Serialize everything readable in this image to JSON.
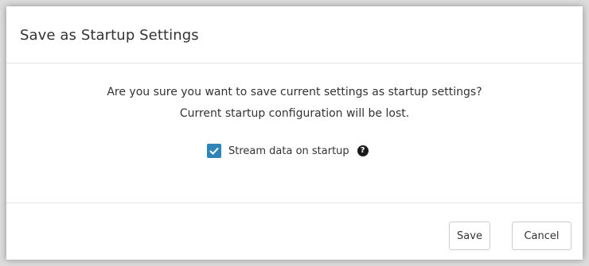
{
  "dialog": {
    "title": "Save as Startup Settings",
    "message_line1": "Are you sure you want to save current settings as startup settings?",
    "message_line2": "Current startup configuration will be lost.",
    "checkbox": {
      "label": "Stream data on startup",
      "checked": true,
      "color": "#2f85b8"
    },
    "help_icon": "question-circle-icon",
    "buttons": {
      "save_label": "Save",
      "cancel_label": "Cancel"
    }
  }
}
